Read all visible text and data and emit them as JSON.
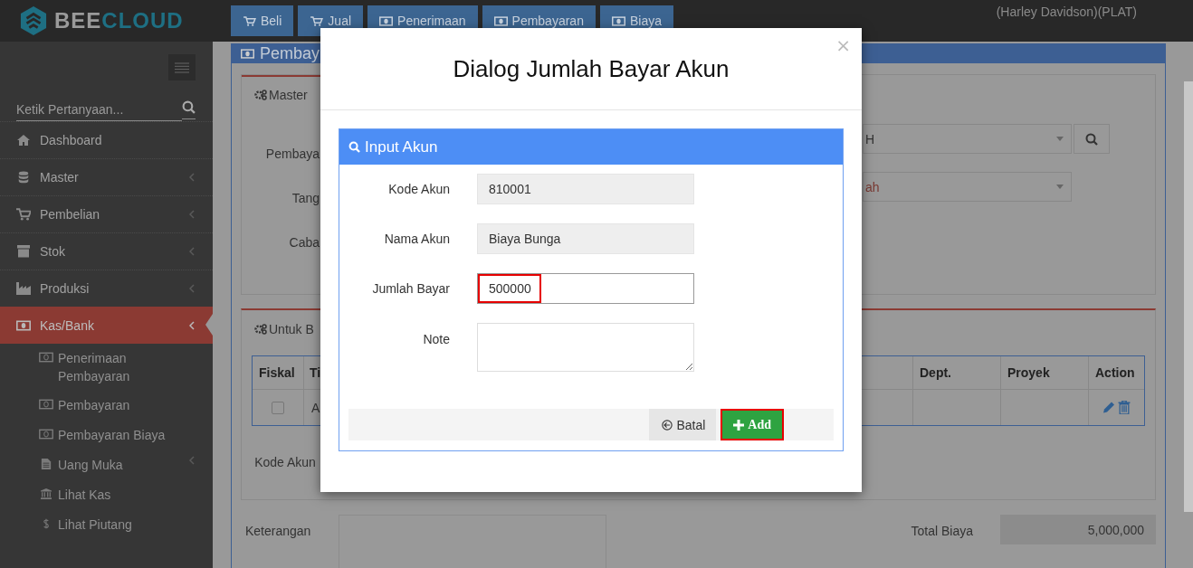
{
  "header": {
    "logo": {
      "part_1": "BEE",
      "part_2": "CLOUD"
    },
    "nav": [
      {
        "label": "Beli",
        "kind": "cart"
      },
      {
        "label": "Jual",
        "kind": "cart"
      },
      {
        "label": "Penerimaan",
        "kind": "money"
      },
      {
        "label": "Pembayaran",
        "kind": "money"
      },
      {
        "label": "Biaya",
        "kind": "money"
      }
    ],
    "user": "(Harley Davidson)(PLAT)"
  },
  "sidebar": {
    "search": {
      "placeholder": "Ketik Pertanyaan..."
    },
    "items": [
      {
        "label": "Dashboard",
        "kind": "home",
        "has_submenu": false,
        "selected": false
      },
      {
        "label": "Master",
        "kind": "database",
        "has_submenu": true,
        "selected": false
      },
      {
        "label": "Pembelian",
        "kind": "cart",
        "has_submenu": true,
        "selected": false
      },
      {
        "label": "Stok",
        "kind": "box",
        "has_submenu": true,
        "selected": false
      },
      {
        "label": "Produksi",
        "kind": "factory",
        "has_submenu": true,
        "selected": false
      },
      {
        "label": "Kas/Bank",
        "kind": "money",
        "has_submenu": true,
        "selected": true,
        "children": [
          {
            "label": "Penerimaan Pembayaran",
            "kind": "money",
            "has_submenu": false
          },
          {
            "label": "Pembayaran",
            "kind": "money",
            "has_submenu": false
          },
          {
            "label": "Pembayaran Biaya",
            "kind": "money",
            "has_submenu": false
          },
          {
            "label": "Uang Muka",
            "kind": "file",
            "has_submenu": true
          },
          {
            "label": "Lihat Kas",
            "kind": "bank",
            "has_submenu": false
          },
          {
            "label": "Lihat Piutang",
            "kind": "dollar",
            "has_submenu": false
          }
        ]
      }
    ]
  },
  "page": {
    "title": "Pembay",
    "master": {
      "tab": "Master",
      "labels": [
        "Pembaya",
        "Tang",
        "Caba"
      ],
      "select_1": "H",
      "select_2": "ah"
    },
    "detail": {
      "tab": "Untuk B",
      "table": {
        "columns": [
          "Fiskal",
          "Ti",
          "Dept.",
          "Proyek",
          "Action"
        ],
        "rows": [
          {
            "checked": false,
            "column_2": "A"
          }
        ]
      },
      "label": "Kode Akun"
    },
    "footer": {
      "keterangan_label": "Keterangan",
      "total_label": "Total Biaya",
      "total_value": "5,000,000"
    }
  },
  "dialog": {
    "title": "Dialog Jumlah Bayar Akun",
    "close": "×",
    "panel_title": "Input Akun",
    "fields": [
      {
        "label": "Kode Akun",
        "kind": "readonly",
        "value": "810001",
        "highlighted": false
      },
      {
        "label": "Nama Akun",
        "kind": "readonly",
        "value": "Biaya Bunga",
        "highlighted": false
      },
      {
        "label": "Jumlah Bayar",
        "kind": "input",
        "value": "500000",
        "highlighted": true
      },
      {
        "label": "Note",
        "kind": "textarea",
        "highlighted": false
      }
    ],
    "buttons": [
      {
        "label": "Batal",
        "kind": "cancel",
        "highlighted": false
      },
      {
        "label": "Add",
        "kind": "add",
        "highlighted": true
      }
    ]
  }
}
